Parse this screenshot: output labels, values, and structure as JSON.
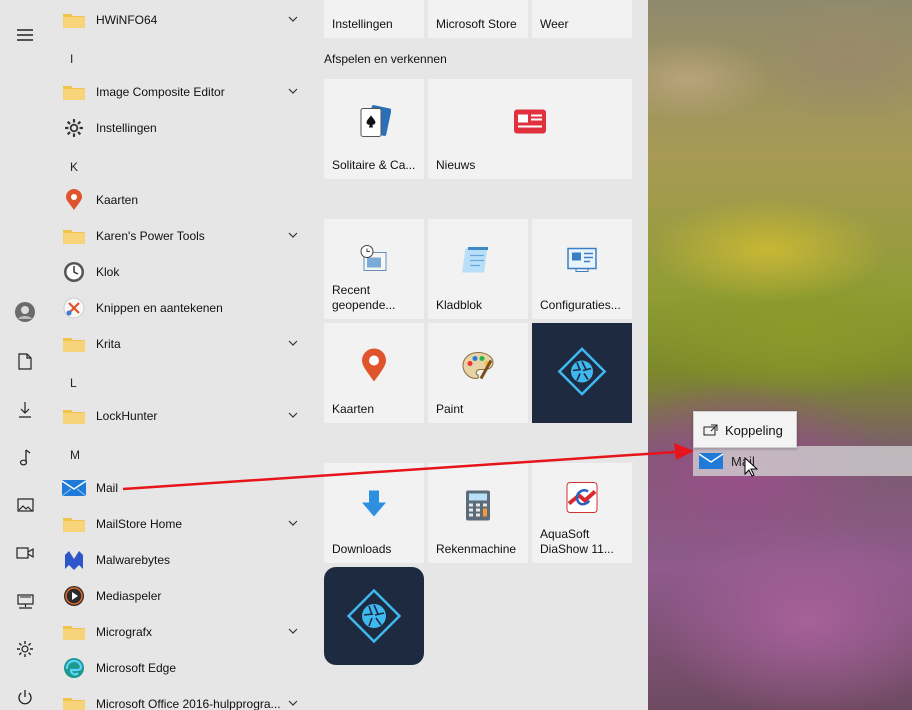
{
  "rail": {
    "items": [
      "menu-icon",
      "avatar",
      "document-icon",
      "download-icon",
      "music-icon",
      "image-icon",
      "video-icon",
      "network-drive-icon",
      "gear-icon",
      "power-icon"
    ]
  },
  "applist": {
    "letters": [
      "I",
      "K",
      "L",
      "M"
    ],
    "items": [
      {
        "label": "HWiNFO64",
        "icon": "folder-icon",
        "expand": true
      },
      {
        "label": "Image Composite Editor",
        "icon": "folder-icon",
        "expand": true
      },
      {
        "label": "Instellingen",
        "icon": "gear-icon",
        "expand": false
      },
      {
        "label": "Kaarten",
        "icon": "map-pin-icon",
        "expand": false
      },
      {
        "label": "Karen's Power Tools",
        "icon": "folder-icon",
        "expand": true
      },
      {
        "label": "Klok",
        "icon": "clock-icon",
        "expand": false
      },
      {
        "label": "Knippen en aantekenen",
        "icon": "snip-icon",
        "expand": false
      },
      {
        "label": "Krita",
        "icon": "folder-icon",
        "expand": true
      },
      {
        "label": "LockHunter",
        "icon": "folder-icon",
        "expand": true
      },
      {
        "label": "Mail",
        "icon": "mail-icon",
        "expand": false
      },
      {
        "label": "MailStore Home",
        "icon": "folder-icon",
        "expand": true
      },
      {
        "label": "Malwarebytes",
        "icon": "malwarebytes-icon",
        "expand": false
      },
      {
        "label": "Mediaspeler",
        "icon": "media-player-icon",
        "expand": false
      },
      {
        "label": "Micrografx",
        "icon": "folder-icon",
        "expand": true
      },
      {
        "label": "Microsoft Edge",
        "icon": "edge-icon",
        "expand": false
      },
      {
        "label": "Microsoft Office 2016-hulpprogra...",
        "icon": "folder-icon",
        "expand": true
      }
    ]
  },
  "tiles": {
    "top_row": [
      "Instellingen",
      "Microsoft Store",
      "Weer"
    ],
    "group_title": "Afspelen en verkennen",
    "solitaire": "Solitaire & Ca...",
    "nieuws": "Nieuws",
    "recent": "Recent\ngeopende...",
    "kladblok": "Kladblok",
    "config": "Configuraties...",
    "kaarten": "Kaarten",
    "paint": "Paint",
    "downloads": "Downloads",
    "rekenmachine": "Rekenmachine",
    "aquasoft": "AquaSoft\nDiaShow 11..."
  },
  "drag": {
    "tooltip": "Koppeling",
    "ghost_label": "Mail"
  },
  "colors": {
    "annotation_arrow": "#e8141b",
    "folder": "#f2c14e",
    "accent_blue": "#1f7ad8",
    "photoshop_bg": "#1e2a40"
  }
}
